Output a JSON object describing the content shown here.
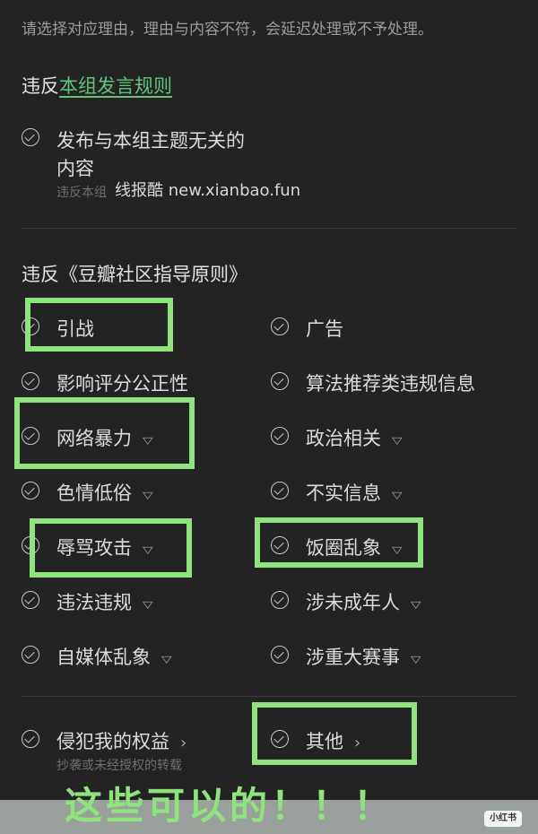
{
  "notice": "请选择对应理由，理由与内容不符，会延迟处理或不予处理。",
  "section1": {
    "prefix": "违反",
    "link": "本组发言规则",
    "option": {
      "label_line1": "发布与本组主题无关的",
      "label_line2": "内容",
      "desc": "违反本组"
    }
  },
  "watermark": "线报酷 new.xianbao.fun",
  "section2": {
    "title": "违反《豆瓣社区指导原则》",
    "options": [
      {
        "label": "引战",
        "chevron": false
      },
      {
        "label": "广告",
        "chevron": false
      },
      {
        "label": "影响评分公正性",
        "chevron": false
      },
      {
        "label": "算法推荐类违规信息",
        "chevron": false
      },
      {
        "label": "网络暴力",
        "chevron": true
      },
      {
        "label": "政治相关",
        "chevron": true
      },
      {
        "label": "色情低俗",
        "chevron": true
      },
      {
        "label": "不实信息",
        "chevron": true
      },
      {
        "label": "辱骂攻击",
        "chevron": true
      },
      {
        "label": "饭圈乱象",
        "chevron": true
      },
      {
        "label": "违法违规",
        "chevron": true
      },
      {
        "label": "涉未成年人",
        "chevron": true
      },
      {
        "label": "自媒体乱象",
        "chevron": true
      },
      {
        "label": "涉重大赛事",
        "chevron": true
      }
    ]
  },
  "section3": {
    "rights": {
      "label": "侵犯我的权益",
      "desc": "抄袭或未经授权的转载"
    },
    "other": {
      "label": "其他"
    }
  },
  "caption": "这些可以的！！！",
  "logo": "小红书",
  "highlight_color": "#8ee37c",
  "link_color": "#62c27a",
  "icons": {
    "option": "check-circle-icon",
    "expand": "chevron-down-icon",
    "forward": "chevron-right-icon"
  }
}
